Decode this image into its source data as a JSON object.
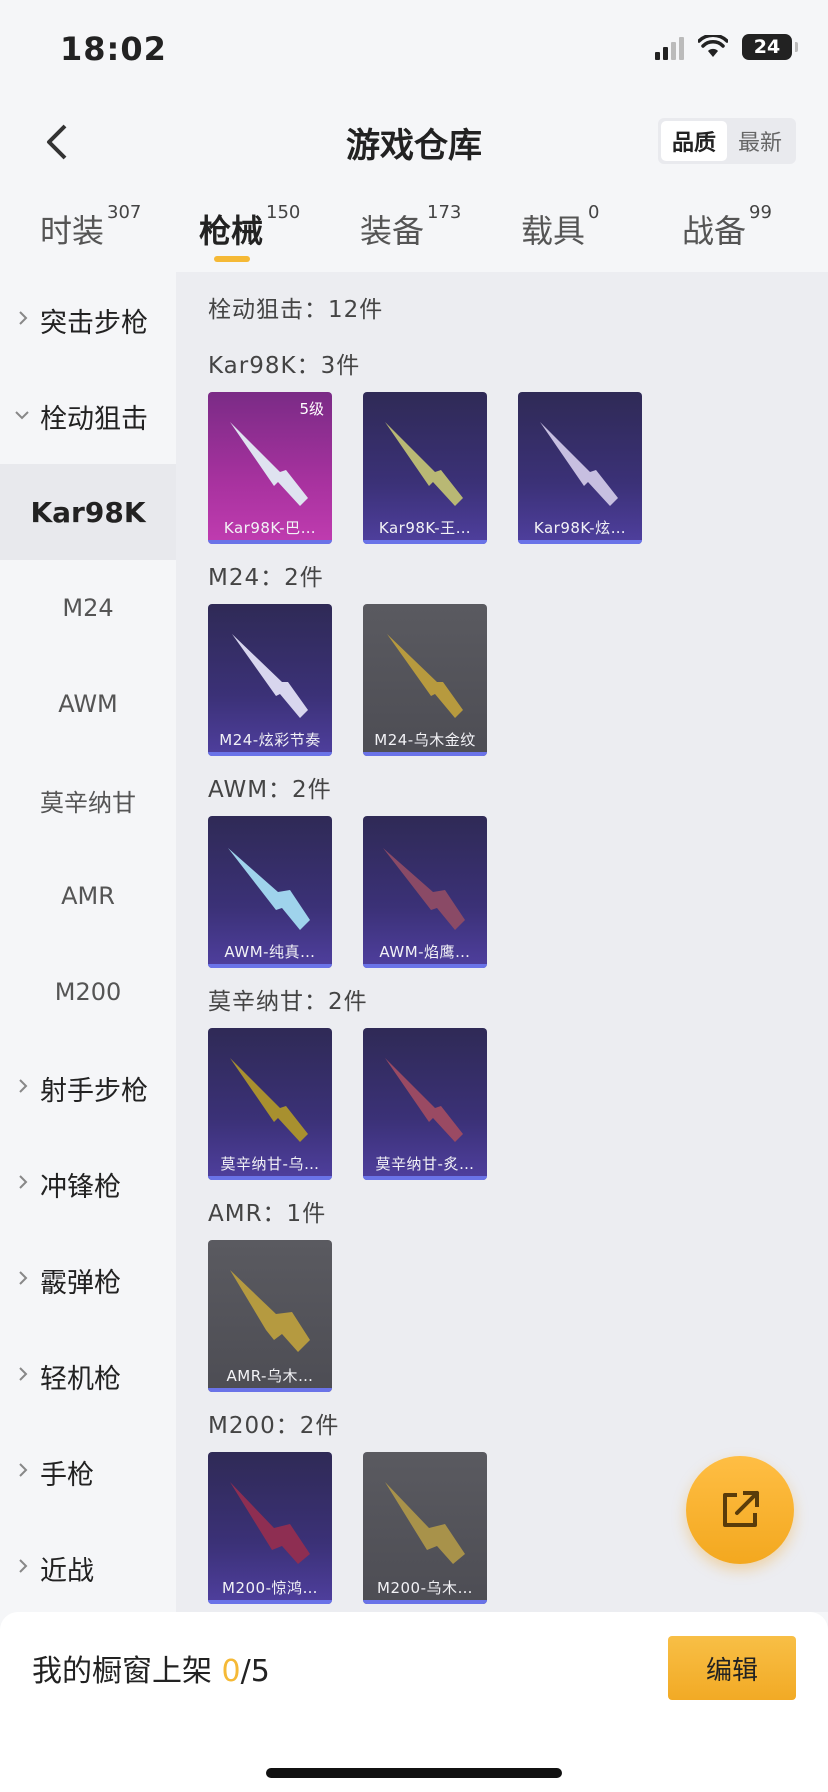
{
  "status_bar": {
    "time": "18:02",
    "battery": "24"
  },
  "header": {
    "title": "游戏仓库",
    "sort_options": [
      "品质",
      "最新"
    ],
    "active_sort": "品质"
  },
  "tabs": [
    {
      "label": "时装",
      "count": "307"
    },
    {
      "label": "枪械",
      "count": "150"
    },
    {
      "label": "装备",
      "count": "173"
    },
    {
      "label": "载具",
      "count": "0"
    },
    {
      "label": "战备",
      "count": "99"
    }
  ],
  "sidebar": {
    "items": [
      {
        "label": "突击步枪",
        "kind": "group"
      },
      {
        "label": "栓动狙击",
        "kind": "group-open"
      },
      {
        "label": "Kar98K",
        "kind": "sub-active"
      },
      {
        "label": "M24",
        "kind": "sub"
      },
      {
        "label": "AWM",
        "kind": "sub"
      },
      {
        "label": "莫辛纳甘",
        "kind": "sub"
      },
      {
        "label": "AMR",
        "kind": "sub"
      },
      {
        "label": "M200",
        "kind": "sub"
      },
      {
        "label": "射手步枪",
        "kind": "group"
      },
      {
        "label": "冲锋枪",
        "kind": "group"
      },
      {
        "label": "霰弹枪",
        "kind": "group"
      },
      {
        "label": "轻机枪",
        "kind": "group"
      },
      {
        "label": "手枪",
        "kind": "group"
      },
      {
        "label": "近战",
        "kind": "group"
      }
    ]
  },
  "content": {
    "category_header": "栓动狙击：12件",
    "sections": [
      {
        "title": "Kar98K：3件",
        "cards": [
          {
            "label": "Kar98K-巴…",
            "level": "5级",
            "bg": "magenta",
            "gun": "#dfe3f0"
          },
          {
            "label": "Kar98K-王…",
            "bg": "purple",
            "gun": "#b9b874"
          },
          {
            "label": "Kar98K-炫…",
            "bg": "purple",
            "gun": "#c7bfe0"
          }
        ]
      },
      {
        "title": "M24：2件",
        "cards": [
          {
            "label": "M24-炫彩节奏",
            "bg": "purple",
            "gun": "#d8d6ee"
          },
          {
            "label": "M24-乌木金纹",
            "bg": "gray",
            "gun": "#b79a3e"
          }
        ]
      },
      {
        "title": "AWM：2件",
        "cards": [
          {
            "label": "AWM-纯真…",
            "bg": "purple",
            "gun": "#9fd3ec"
          },
          {
            "label": "AWM-焰鹰…",
            "bg": "purple",
            "gun": "#8a4a66"
          }
        ]
      },
      {
        "title": "莫辛纳甘：2件",
        "cards": [
          {
            "label": "莫辛纳甘-乌…",
            "bg": "purple",
            "gun": "#a8902f"
          },
          {
            "label": "莫辛纳甘-炙…",
            "bg": "purple",
            "gun": "#9a4a63"
          }
        ]
      },
      {
        "title": "AMR：1件",
        "cards": [
          {
            "label": "AMR-乌木…",
            "bg": "gray",
            "gun": "#b59a40"
          }
        ]
      },
      {
        "title": "M200：2件",
        "cards": [
          {
            "label": "M200-惊鸿…",
            "bg": "purple",
            "gun": "#8e2e52"
          },
          {
            "label": "M200-乌木…",
            "bg": "gray",
            "gun": "#a8924a"
          }
        ]
      }
    ]
  },
  "bottom": {
    "showcase_prefix": "我的橱窗上架 ",
    "showcase_current": "0",
    "showcase_total": "/5",
    "edit_label": "编辑"
  },
  "colors": {
    "accent": "#f5b936",
    "card_purple": "#3b3177",
    "card_magenta": "#a8329f",
    "card_gray": "#4d4d54",
    "rarity_bar": "#6a73e8"
  },
  "icons": {
    "back": "chevron-left-icon",
    "share": "external-link-icon",
    "expand": "chevron-right-icon",
    "collapse": "chevron-down-icon"
  }
}
